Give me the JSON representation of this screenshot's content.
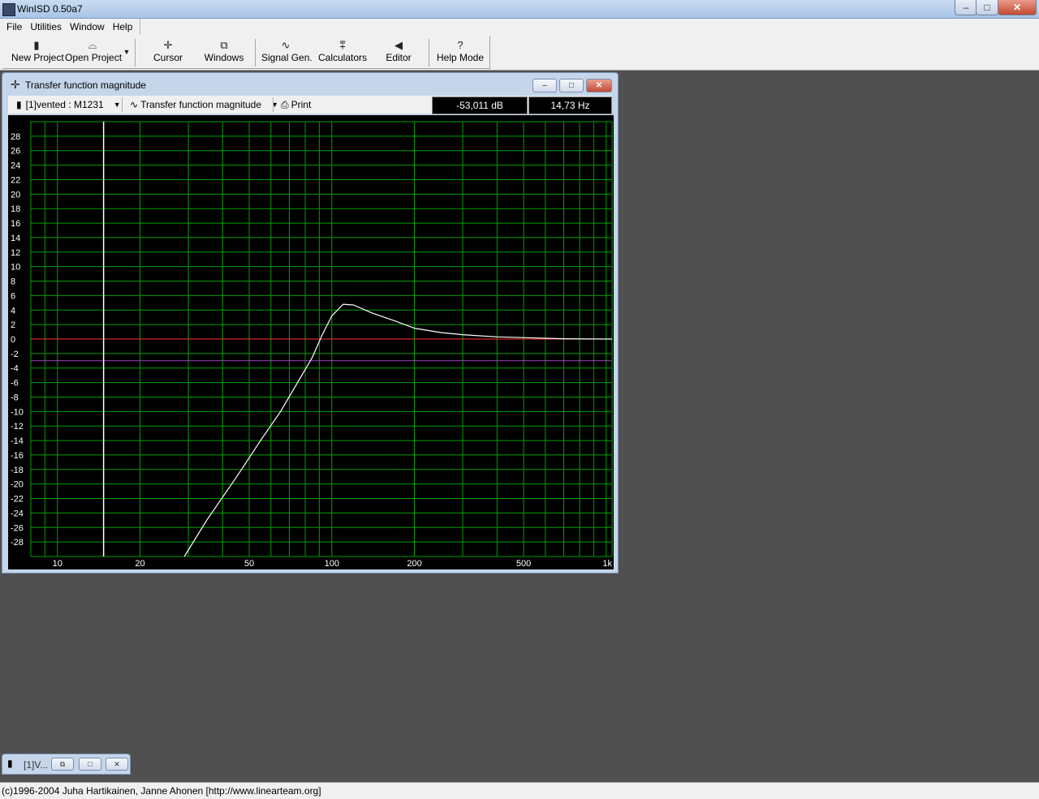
{
  "app": {
    "title": "WinISD 0.50a7",
    "controls": {
      "minimize": "–",
      "maximize": "□",
      "close": "✕"
    }
  },
  "menu": [
    {
      "label": "File"
    },
    {
      "label": "Utilities"
    },
    {
      "label": "Window"
    },
    {
      "label": "Help"
    }
  ],
  "toolbar": {
    "new_project": "New Project",
    "open_project": "Open Project",
    "cursor": "Cursor",
    "windows": "Windows",
    "signal_gen": "Signal Gen.",
    "calculators": "Calculators",
    "editor": "Editor",
    "help_mode": "Help Mode"
  },
  "chart_window": {
    "title": "Transfer function magnitude",
    "project_select": "[1]vented : M1231",
    "graph_select": "Transfer function magnitude",
    "print": "Print",
    "readout_db": "-53,011 dB",
    "readout_hz": "14,73 Hz"
  },
  "chart_data": {
    "type": "line",
    "title": "",
    "xlabel": "",
    "ylabel": "",
    "x_scale": "log",
    "xlim": [
      8,
      1050
    ],
    "ylim": [
      -30,
      30
    ],
    "x_tick_labels": [
      "10",
      "20",
      "50",
      "100",
      "200",
      "500",
      "1k"
    ],
    "x_tick_values": [
      10,
      20,
      50,
      100,
      200,
      500,
      1000
    ],
    "y_tick_values": [
      28,
      26,
      24,
      22,
      20,
      18,
      16,
      14,
      12,
      10,
      8,
      6,
      4,
      2,
      0,
      -2,
      -4,
      -6,
      -8,
      -10,
      -12,
      -14,
      -16,
      -18,
      -20,
      -22,
      -24,
      -26,
      -28
    ],
    "grid": true,
    "colors": {
      "background": "#000000",
      "grid": "#00a000",
      "response": "#ffffff",
      "reference_0db": "#ff3030",
      "reference_minus3db": "#a040c0",
      "cursor": "#ffffff"
    },
    "cursor_x": 14.73,
    "reference_lines": [
      0,
      -3
    ],
    "series": [
      {
        "x": [
          29,
          35,
          45,
          55,
          65,
          75,
          85,
          92,
          100,
          110,
          120,
          140,
          170,
          200,
          250,
          300,
          400,
          500,
          700,
          1050
        ],
        "values": [
          -30,
          -25,
          -19,
          -14,
          -10,
          -6,
          -2.5,
          0.5,
          3.2,
          4.8,
          4.7,
          3.6,
          2.5,
          1.5,
          0.9,
          0.6,
          0.3,
          0.2,
          0.05,
          0.0
        ]
      }
    ]
  },
  "minimized_window": {
    "label": "[1]V..."
  },
  "status": "(c)1996-2004 Juha Hartikainen, Janne Ahonen [http://www.linearteam.org]"
}
